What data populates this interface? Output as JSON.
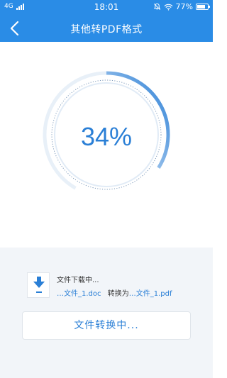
{
  "status_bar": {
    "network": "4G",
    "time": "18:01",
    "battery_percent": "77%",
    "battery_level": 0.77
  },
  "header": {
    "title": "其他转PDF格式",
    "background_color": "#2a8ce6"
  },
  "progress": {
    "label": "34%",
    "value": 0.34,
    "accent_color": "#2a7fd6"
  },
  "task": {
    "status_text": "文件下载中...",
    "source_file": "…文件_1.doc",
    "convert_to_label": "转换为",
    "target_file": "…文件_1.pdf"
  },
  "action": {
    "button_label": "文件转换中..."
  },
  "icons": {
    "back": "chevron-left-icon",
    "download": "download-icon",
    "signal": "signal-icon",
    "mute": "bell-mute-icon",
    "wifi": "wifi-icon",
    "battery": "battery-icon"
  }
}
